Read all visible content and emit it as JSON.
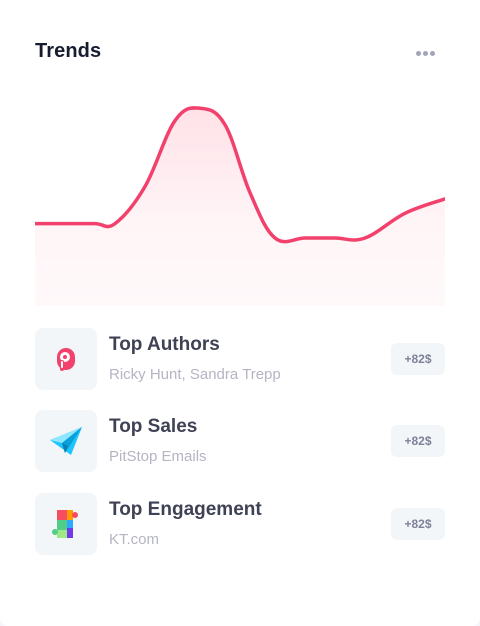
{
  "card": {
    "title": "Trends"
  },
  "chart_data": {
    "type": "area",
    "description_series": [
      {
        "values": [
          40,
          40,
          40,
          40,
          58,
          90,
          96,
          88,
          55,
          33,
          33,
          33,
          33,
          45,
          52
        ]
      }
    ],
    "x": [
      0,
      30,
      60,
      80,
      110,
      140,
      165,
      190,
      215,
      240,
      270,
      300,
      330,
      370,
      410
    ],
    "xlabel": "",
    "ylabel": "",
    "grid": false,
    "colors": {
      "line": "#f1416c",
      "fill": "#fff0f3"
    }
  },
  "list": {
    "items": [
      {
        "title": "Top Authors",
        "subtitle": "Ricky Hunt, Sandra Trepp",
        "badge": "+82$",
        "icon": "p-logo-icon"
      },
      {
        "title": "Top Sales",
        "subtitle": "PitStop Emails",
        "badge": "+82$",
        "icon": "paper-plane-icon"
      },
      {
        "title": "Top Engagement",
        "subtitle": "KT.com",
        "badge": "+82$",
        "icon": "puzzle-icon"
      }
    ]
  },
  "more_icon": "dots-horizontal-icon"
}
